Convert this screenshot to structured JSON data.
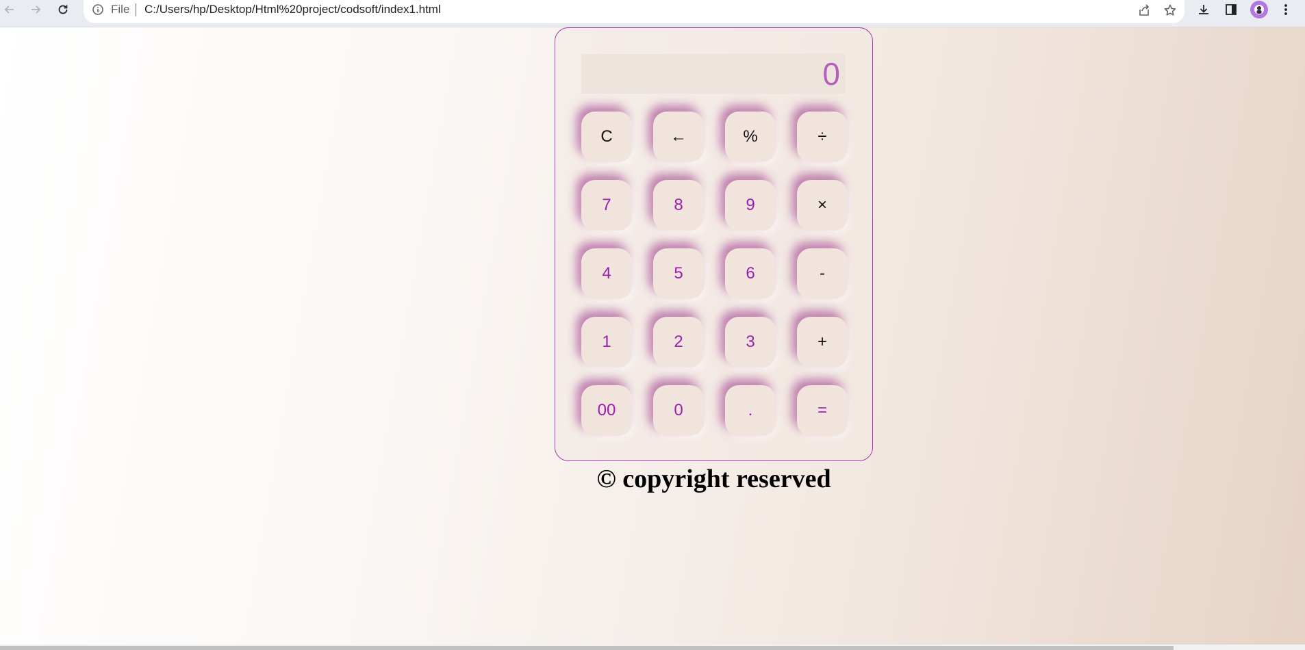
{
  "browser": {
    "scheme_label": "File",
    "url": "C:/Users/hp/Desktop/Html%20project/codsoft/index1.html",
    "icons": {
      "back": "back-arrow-icon",
      "forward": "forward-arrow-icon",
      "reload": "reload-icon",
      "info": "info-icon",
      "share": "share-icon",
      "bookmark": "star-icon",
      "download": "download-icon",
      "side_panel": "side-panel-icon",
      "profile": "profile-avatar",
      "menu": "kebab-menu-icon"
    }
  },
  "calculator": {
    "display_value": "0",
    "keys": [
      {
        "label": "C",
        "kind": "op"
      },
      {
        "label": "←",
        "kind": "op"
      },
      {
        "label": "%",
        "kind": "op"
      },
      {
        "label": "÷",
        "kind": "op"
      },
      {
        "label": "7",
        "kind": "digit"
      },
      {
        "label": "8",
        "kind": "digit"
      },
      {
        "label": "9",
        "kind": "digit"
      },
      {
        "label": "×",
        "kind": "op"
      },
      {
        "label": "4",
        "kind": "digit"
      },
      {
        "label": "5",
        "kind": "digit"
      },
      {
        "label": "6",
        "kind": "digit"
      },
      {
        "label": "-",
        "kind": "op"
      },
      {
        "label": "1",
        "kind": "digit"
      },
      {
        "label": "2",
        "kind": "digit"
      },
      {
        "label": "3",
        "kind": "digit"
      },
      {
        "label": "+",
        "kind": "op"
      },
      {
        "label": "00",
        "kind": "digit"
      },
      {
        "label": "0",
        "kind": "digit"
      },
      {
        "label": ".",
        "kind": "digit"
      },
      {
        "label": "=",
        "kind": "equals"
      }
    ]
  },
  "footer": {
    "copyright": "© copyright reserved"
  },
  "colors": {
    "accent": "#9b1fae",
    "display_text": "#b65fb6",
    "border": "#a63aa6"
  }
}
